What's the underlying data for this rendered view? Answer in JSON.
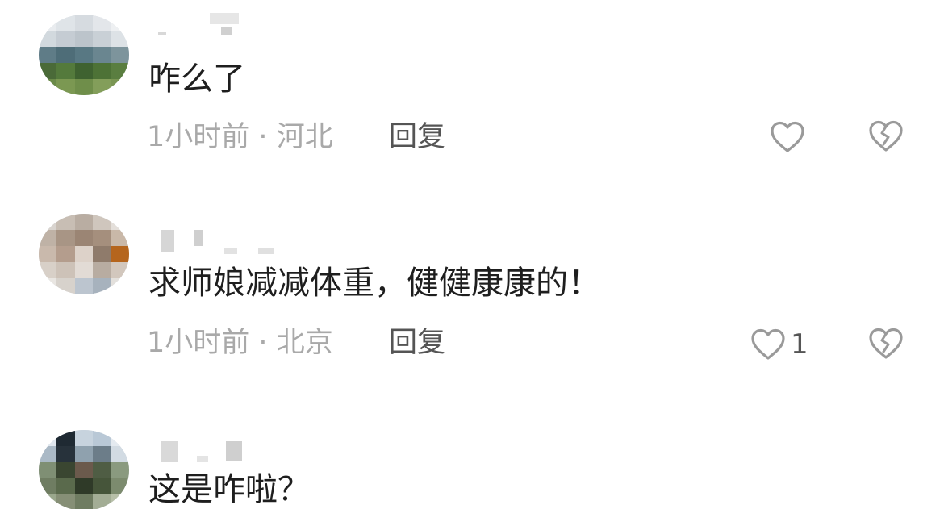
{
  "comments": [
    {
      "text": "咋么了",
      "time": "1小时前",
      "separator": "·",
      "location": "河北",
      "reply_label": "回复",
      "like_count": "",
      "like_icon": "heart-outline-icon",
      "dislike_icon": "broken-heart-icon"
    },
    {
      "text": "求师娘减减体重，健健康康的！",
      "time": "1小时前",
      "separator": "·",
      "location": "北京",
      "reply_label": "回复",
      "like_count": "1",
      "like_icon": "heart-outline-icon",
      "dislike_icon": "broken-heart-icon"
    },
    {
      "text": "这是咋啦？"
    }
  ],
  "colors": {
    "text": "#1e1e1e",
    "meta": "#a9a9a9",
    "reply": "#555555",
    "icon": "#9a9a9a"
  }
}
